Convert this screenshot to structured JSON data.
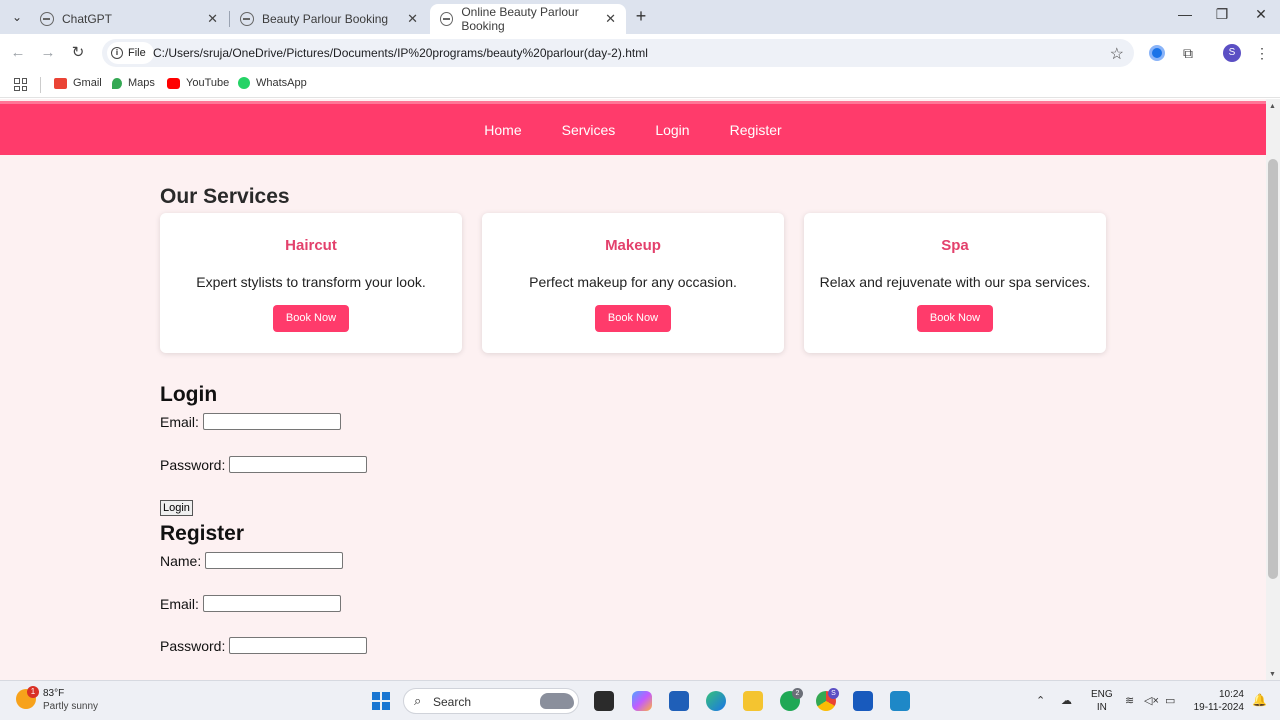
{
  "browser": {
    "tabs": [
      {
        "title": "ChatGPT",
        "close": "✕"
      },
      {
        "title": "Beauty Parlour Booking",
        "close": "✕"
      },
      {
        "title": "Online Beauty Parlour Booking",
        "close": "✕"
      }
    ],
    "new_tab": "+",
    "window_controls": {
      "minimize": "—",
      "maximize": "❐",
      "close": "✕"
    },
    "address": {
      "chip": "File",
      "url": "C:/Users/sruja/OneDrive/Pictures/Documents/IP%20programs/beauty%20parlour(day-2).html"
    },
    "profile_initial": "S",
    "bookmarks": [
      {
        "label": "Gmail",
        "color": "#ea4335"
      },
      {
        "label": "Maps",
        "color": "#34a853"
      },
      {
        "label": "YouTube",
        "color": "#ff0000"
      },
      {
        "label": "WhatsApp",
        "color": "#25d366"
      }
    ]
  },
  "site": {
    "nav": [
      "Home",
      "Services",
      "Login",
      "Register"
    ],
    "services_title": "Our Services",
    "services": [
      {
        "name": "Haircut",
        "desc": "Expert stylists to transform your look.",
        "button": "Book Now"
      },
      {
        "name": "Makeup",
        "desc": "Perfect makeup for any occasion.",
        "button": "Book Now"
      },
      {
        "name": "Spa",
        "desc": "Relax and rejuvenate with our spa services.",
        "button": "Book Now"
      }
    ],
    "login": {
      "title": "Login",
      "email_label": "Email:",
      "password_label": "Password:",
      "submit": "Login"
    },
    "register": {
      "title": "Register",
      "name_label": "Name:",
      "email_label": "Email:",
      "password_label": "Password:"
    },
    "colors": {
      "accent": "#ff3b6b",
      "service_title": "#e3416c",
      "background": "#fdf1f2"
    }
  },
  "taskbar": {
    "weather": {
      "temp": "83°F",
      "desc": "Partly sunny",
      "badge": "1"
    },
    "search_label": "Search",
    "whatsapp_badge": "2",
    "chrome_badge": "S",
    "language": {
      "line1": "ENG",
      "line2": "IN"
    },
    "clock": {
      "time": "10:24",
      "date": "19-11-2024"
    }
  }
}
